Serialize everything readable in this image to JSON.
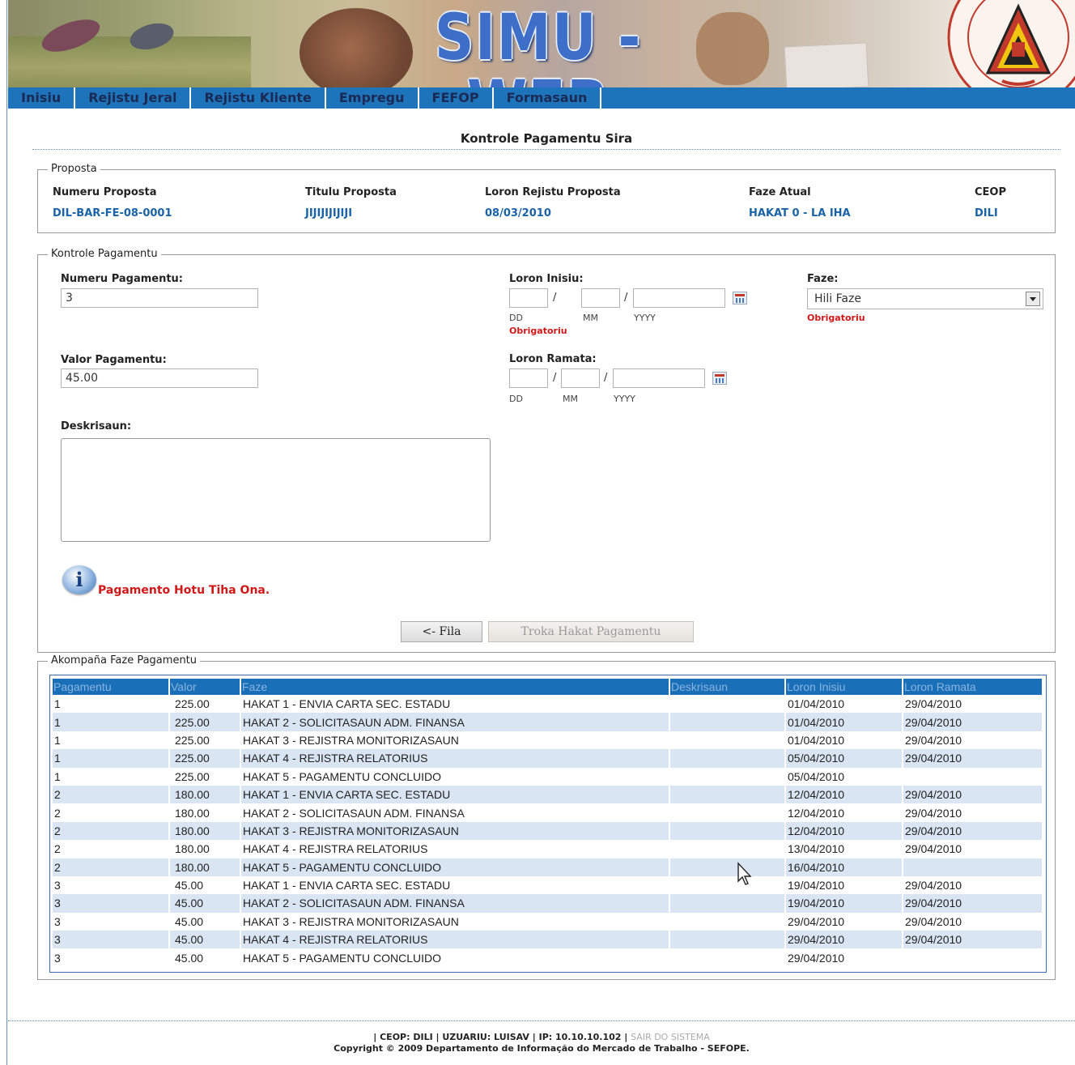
{
  "banner": {
    "title": "SIMU - WEB",
    "emblem": "timor-leste-emblem"
  },
  "nav": [
    "Inisiu",
    "Rejistu Jeral",
    "Rejistu Kliente",
    "Empregu",
    "FEFOP",
    "Formasaun"
  ],
  "page_title": "Kontrole Pagamentu Sira",
  "proposta": {
    "legend": "Proposta",
    "labels": {
      "numeru": "Numeru Proposta",
      "titulu": "Titulu Proposta",
      "loron": "Loron Rejistu Proposta",
      "faze": "Faze Atual",
      "ceop": "CEOP"
    },
    "values": {
      "numeru": "DIL-BAR-FE-08-0001",
      "titulu": "JIJIJIJIJIJI",
      "loron": "08/03/2010",
      "faze": "HAKAT 0 - LA IHA",
      "ceop": "DILI"
    }
  },
  "kontrole": {
    "legend": "Kontrole Pagamentu",
    "numeru_label": "Numeru Pagamentu:",
    "numeru_value": "3",
    "valor_label": "Valor Pagamentu:",
    "valor_value": "45.00",
    "deskrisaun_label": "Deskrisaun:",
    "loron_inisiu_label": "Loron Inisiu:",
    "loron_ramata_label": "Loron Ramata:",
    "date_sep": "/",
    "dd": "DD",
    "mm": "MM",
    "yyyy": "YYYY",
    "obrigatoriu": "Obrigatoriu",
    "faze_label": "Faze:",
    "faze_selected": "Hili Faze",
    "message": "Pagamento Hotu Tiha Ona.",
    "info_glyph": "i",
    "btn_back": "<- Fila",
    "btn_troka": "Troka Hakat Pagamentu"
  },
  "akompana": {
    "legend": "Akompaña Faze Pagamentu",
    "headers": [
      "Pagamentu",
      "Valor",
      "Faze",
      "Deskrisaun",
      "Loron Inisiu",
      "Loron Ramata"
    ],
    "rows": [
      [
        "1",
        "225.00",
        "HAKAT 1 - ENVIA CARTA SEC. ESTADU",
        "",
        "01/04/2010",
        "29/04/2010"
      ],
      [
        "1",
        "225.00",
        "HAKAT 2 - SOLICITASAUN ADM. FINANSA",
        "",
        "01/04/2010",
        "29/04/2010"
      ],
      [
        "1",
        "225.00",
        "HAKAT 3 - REJISTRA MONITORIZASAUN",
        "",
        "01/04/2010",
        "29/04/2010"
      ],
      [
        "1",
        "225.00",
        "HAKAT 4 - REJISTRA RELATORIUS",
        "",
        "05/04/2010",
        "29/04/2010"
      ],
      [
        "1",
        "225.00",
        "HAKAT 5 - PAGAMENTU CONCLUIDO",
        "",
        "05/04/2010",
        ""
      ],
      [
        "2",
        "180.00",
        "HAKAT 1 - ENVIA CARTA SEC. ESTADU",
        "",
        "12/04/2010",
        "29/04/2010"
      ],
      [
        "2",
        "180.00",
        "HAKAT 2 - SOLICITASAUN ADM. FINANSA",
        "",
        "12/04/2010",
        "29/04/2010"
      ],
      [
        "2",
        "180.00",
        "HAKAT 3 - REJISTRA MONITORIZASAUN",
        "",
        "12/04/2010",
        "29/04/2010"
      ],
      [
        "2",
        "180.00",
        "HAKAT 4 - REJISTRA RELATORIUS",
        "",
        "13/04/2010",
        "29/04/2010"
      ],
      [
        "2",
        "180.00",
        "HAKAT 5 - PAGAMENTU CONCLUIDO",
        "",
        "16/04/2010",
        ""
      ],
      [
        "3",
        "45.00",
        "HAKAT 1 - ENVIA CARTA SEC. ESTADU",
        "",
        "19/04/2010",
        "29/04/2010"
      ],
      [
        "3",
        "45.00",
        "HAKAT 2 - SOLICITASAUN ADM. FINANSA",
        "",
        "19/04/2010",
        "29/04/2010"
      ],
      [
        "3",
        "45.00",
        "HAKAT 3 - REJISTRA MONITORIZASAUN",
        "",
        "29/04/2010",
        "29/04/2010"
      ],
      [
        "3",
        "45.00",
        "HAKAT 4 - REJISTRA RELATORIUS",
        "",
        "29/04/2010",
        "29/04/2010"
      ],
      [
        "3",
        "45.00",
        "HAKAT 5 - PAGAMENTU CONCLUIDO",
        "",
        "29/04/2010",
        ""
      ]
    ]
  },
  "footer": {
    "status": "| CEOP: DILI | UZUARIU: LUISAV | IP: 10.10.10.102 |",
    "exit": "SAIR DO SISTEMA",
    "copyright": "Copyright © 2009 Departamento de Informação do Mercado de Trabalho - SEFOPE."
  },
  "colors": {
    "nav": "#1d74bb",
    "link_blue": "#1a63a8",
    "required_red": "#d01818",
    "row_alt": "#d9e5f2",
    "table_header": "#1a6fb9"
  }
}
